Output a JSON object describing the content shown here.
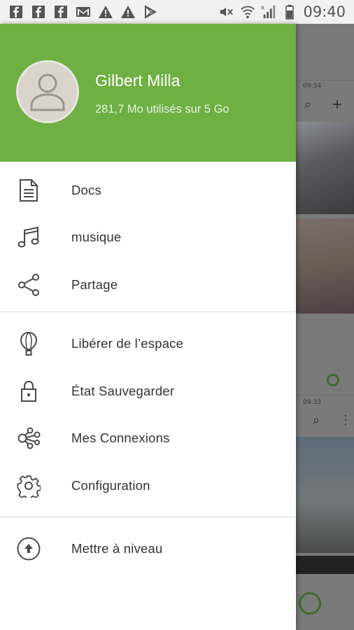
{
  "status_bar": {
    "time": "09:40",
    "left_icons": [
      "facebook-icon",
      "facebook-icon",
      "facebook-icon",
      "gmail-icon",
      "warning-icon",
      "warning-icon",
      "play-store-icon"
    ],
    "right_icons": [
      "mute-icon",
      "wifi-icon",
      "signal-icon",
      "battery-icon"
    ]
  },
  "profile": {
    "name": "Gilbert Milla",
    "usage": "281,7 Mo utilisés sur 5 Go"
  },
  "menu": {
    "section1": [
      {
        "label": "Docs",
        "icon": "document-icon"
      },
      {
        "label": "musique",
        "icon": "music-icon"
      },
      {
        "label": "Partage",
        "icon": "share-icon"
      }
    ],
    "section2": [
      {
        "label": "Libérer de l’espace",
        "icon": "balloon-icon"
      },
      {
        "label": "État Sauvegarder",
        "icon": "lock-icon"
      },
      {
        "label": "Mes Connexions",
        "icon": "connections-icon"
      },
      {
        "label": "Configuration",
        "icon": "gear-icon"
      }
    ],
    "section3": [
      {
        "label": "Mettre à niveau",
        "icon": "upgrade-icon"
      }
    ]
  },
  "background": {
    "time1": "09:34",
    "time2": "09:33"
  },
  "colors": {
    "header_green": "#6eb043",
    "text": "#333333",
    "icon": "#4a4a4a"
  }
}
